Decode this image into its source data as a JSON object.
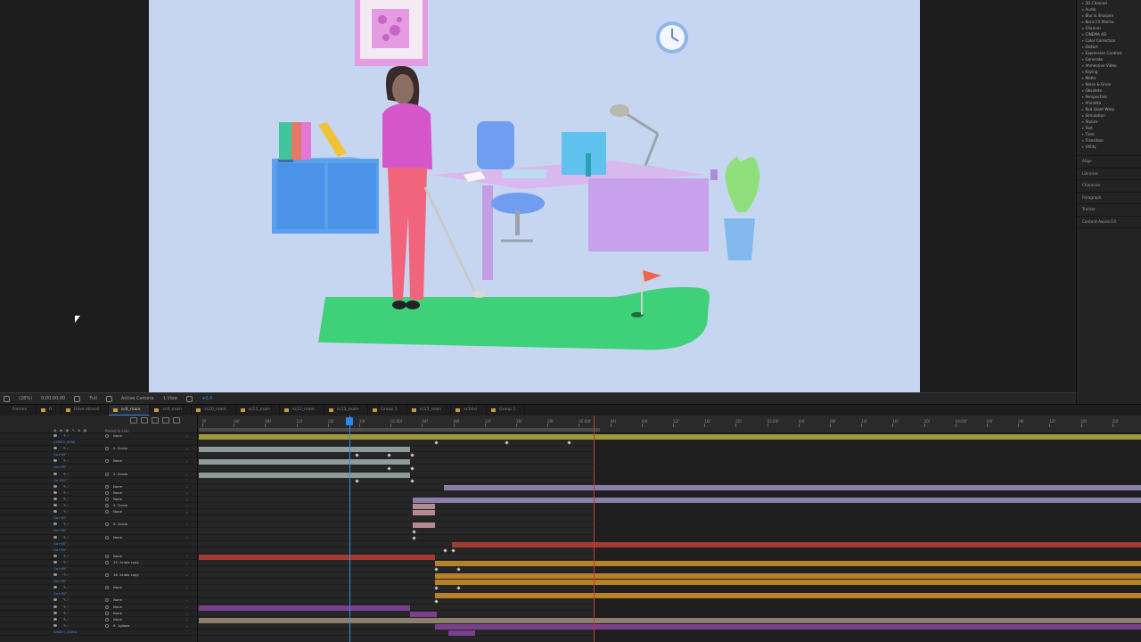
{
  "viewer_toolbar": {
    "zoom": "(28%)",
    "timecode": "0;00;00;00",
    "quality": "Full",
    "camera": "Active Camera",
    "views": "1 View",
    "exposure": "+0.0"
  },
  "effects_panel": {
    "categories": [
      "3D Channel",
      "Audio",
      "Blur & Sharpen",
      "Boris FX Mocha",
      "Channel",
      "CINEMA 4D",
      "Color Correction",
      "Distort",
      "Expression Controls",
      "Generate",
      "Immersive Video",
      "Keying",
      "Matte",
      "Noise & Grain",
      "Obsolete",
      "Perspective",
      "Primatte",
      "Red Giant Warp",
      "Simulation",
      "Stylize",
      "Text",
      "Time",
      "Transition",
      "Utility"
    ],
    "panels": [
      "Align",
      "Libraries",
      "Character",
      "Paragraph",
      "Tracker",
      "Content-Aware Fill"
    ]
  },
  "timeline_tabs": [
    {
      "label": "frames",
      "active": false
    },
    {
      "label": "fi",
      "active": false
    },
    {
      "label": "Olive strand",
      "active": false
    },
    {
      "label": "sc8_main",
      "active": true
    },
    {
      "label": "sc9_main",
      "active": false
    },
    {
      "label": "sc10_main",
      "active": false
    },
    {
      "label": "sc11_main",
      "active": false
    },
    {
      "label": "sc12_main",
      "active": false
    },
    {
      "label": "sc13_main",
      "active": false
    },
    {
      "label": "Group 1",
      "active": false
    },
    {
      "label": "sc15_main",
      "active": false
    },
    {
      "label": "sc14el",
      "active": false
    },
    {
      "label": "Group 1",
      "active": false
    }
  ],
  "layer_panel": {
    "header": "Parent & Link",
    "rows": [
      {
        "parent": "None",
        "label": ""
      },
      {
        "parent": "",
        "label": "AllNEO_ZOBJ"
      },
      {
        "parent": "3. 2cialo",
        "label": ""
      },
      {
        "parent": "",
        "label": "Go+65°"
      },
      {
        "parent": "None",
        "label": ""
      },
      {
        "parent": "",
        "label": "Go+65°"
      },
      {
        "parent": "3. 2cialo",
        "label": ""
      },
      {
        "parent": "",
        "label": "Go 530°"
      },
      {
        "parent": "None",
        "label": ""
      },
      {
        "parent": "None",
        "label": ""
      },
      {
        "parent": "None",
        "label": ""
      },
      {
        "parent": "9. 2cialo",
        "label": ""
      },
      {
        "parent": "None",
        "label": ""
      },
      {
        "parent": "",
        "label": "Go+65°"
      },
      {
        "parent": "9. 2cialo",
        "label": ""
      },
      {
        "parent": "",
        "label": "Go+65°"
      },
      {
        "parent": "None",
        "label": ""
      },
      {
        "parent": "",
        "label": "Go+65°"
      },
      {
        "parent": "",
        "label": "Go+65°"
      },
      {
        "parent": "None",
        "label": ""
      },
      {
        "parent": "15. 2cialo copy",
        "label": ""
      },
      {
        "parent": "",
        "label": "Go+65°"
      },
      {
        "parent": "16. 2cialo copy",
        "label": ""
      },
      {
        "parent": "",
        "label": "Go+65°"
      },
      {
        "parent": "None",
        "label": ""
      },
      {
        "parent": "",
        "label": "Go+65°"
      },
      {
        "parent": "None",
        "label": ""
      },
      {
        "parent": "None",
        "label": ""
      },
      {
        "parent": "None",
        "label": ""
      },
      {
        "parent": "None",
        "label": ""
      },
      {
        "parent": "6. 1glowa",
        "label": ""
      },
      {
        "parent": "",
        "label": "AllNEO_2BXla"
      }
    ]
  },
  "time_ruler": {
    "ticks": [
      "0f",
      "04f",
      "08f",
      "12f",
      "16f",
      "20f",
      "01:00f",
      "04f",
      "08f",
      "12f",
      "16f",
      "20f",
      "02:00f",
      "04f",
      "08f",
      "12f",
      "16f",
      "20f",
      "03:00f",
      "04f",
      "08f",
      "12f",
      "16f",
      "20f",
      "04:00f",
      "04f",
      "08f",
      "12f",
      "16f",
      "20f"
    ]
  },
  "colors": {
    "accent": "#2d8ceb",
    "scene_bg": "#c7d6f0",
    "track_olive": "#9c9a3a",
    "track_gray": "#8f9a9a",
    "track_lavender": "#8a7fa8",
    "track_pink": "#b58a92",
    "track_red": "#a33b35",
    "track_orange": "#b7812a",
    "track_purple": "#7b3f8f",
    "track_tan": "#8e7f6d"
  }
}
